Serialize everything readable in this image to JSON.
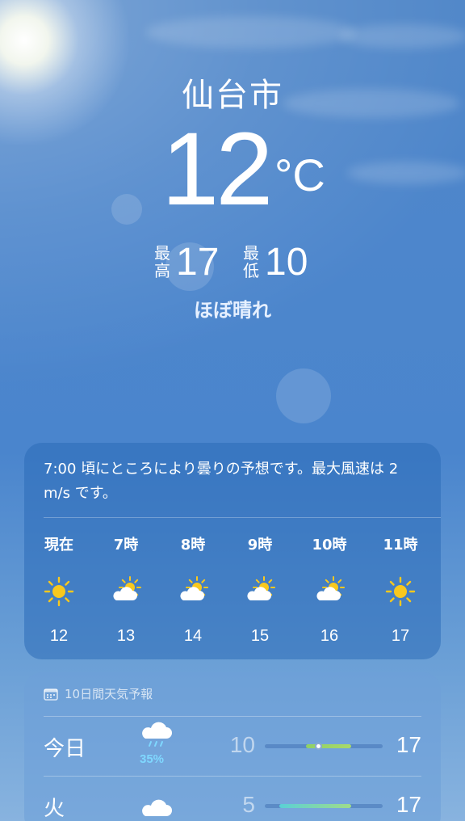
{
  "location": {
    "city": "仙台市",
    "temperature": "12",
    "unit": "°C",
    "high_label": "最高",
    "high": "17",
    "low_label": "最低",
    "low": "10",
    "condition": "ほぼ晴れ"
  },
  "hourly": {
    "summary": "7:00 頃にところにより曇りの予想です。最大風速は 2 m/s です。",
    "items": [
      {
        "label": "現在",
        "icon": "sun-icon",
        "temp": "12"
      },
      {
        "label": "7時",
        "icon": "partly-cloudy-icon",
        "temp": "13"
      },
      {
        "label": "8時",
        "icon": "partly-cloudy-icon",
        "temp": "14"
      },
      {
        "label": "9時",
        "icon": "partly-cloudy-icon",
        "temp": "15"
      },
      {
        "label": "10時",
        "icon": "partly-cloudy-icon",
        "temp": "16"
      },
      {
        "label": "11時",
        "icon": "sun-icon",
        "temp": "17"
      }
    ]
  },
  "forecast": {
    "title": "10日間天気予報",
    "days": [
      {
        "day": "今日",
        "icon": "rain-cloud-icon",
        "precip": "35%",
        "low": "10",
        "high": "17",
        "range_start": 0.35,
        "range_end": 0.73,
        "current": 0.45,
        "colors": [
          "#8fd067",
          "#a9d96a"
        ]
      },
      {
        "day": "火",
        "icon": "cloud-icon",
        "precip": "",
        "low": "5",
        "high": "17",
        "range_start": 0.12,
        "range_end": 0.73,
        "current": null,
        "colors": [
          "#5ad0d6",
          "#9fdc8a"
        ]
      }
    ]
  },
  "colors": {
    "sun": "#f8c81e",
    "precip": "#7fd8ff"
  }
}
